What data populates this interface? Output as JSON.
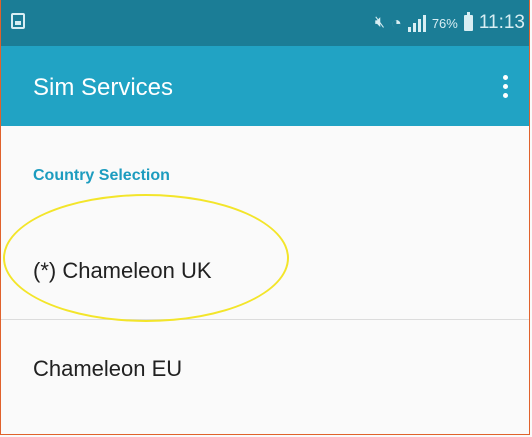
{
  "statusbar": {
    "battery_pct": "76%",
    "time": "11:13"
  },
  "appbar": {
    "title": "Sim Services"
  },
  "section": {
    "header": "Country Selection"
  },
  "options": [
    {
      "label": "(*) Chameleon UK",
      "selected": true
    },
    {
      "label": "Chameleon EU",
      "selected": false
    }
  ],
  "icons": {
    "status_left": "sim-card-icon",
    "mute": "mute-icon",
    "wifi": "wifi-icon",
    "signal": "signal-icon",
    "battery": "battery-icon",
    "menu": "overflow-menu-icon"
  },
  "colors": {
    "statusbar": "#1b7d96",
    "appbar": "#21a3c4",
    "section_header": "#1c9cbf",
    "highlight": "#f3e52a"
  }
}
